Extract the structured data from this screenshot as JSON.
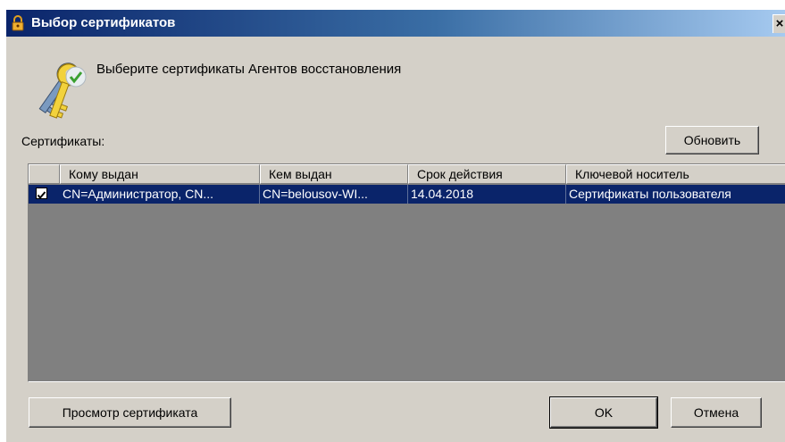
{
  "dialog": {
    "title": "Выбор сертификатов",
    "close_glyph": "×",
    "instruction": "Выберите сертификаты Агентов восстановления",
    "certificates_label": "Сертификаты:",
    "refresh_label": "Обновить",
    "view_label": "Просмотр сертификата",
    "ok_label": "OK",
    "cancel_label": "Отмена"
  },
  "table": {
    "columns": [
      "Кому выдан",
      "Кем выдан",
      "Срок действия",
      "Ключевой носитель"
    ],
    "rows": [
      {
        "checked": true,
        "cells": [
          "CN=Администратор, CN...",
          "CN=belousov-WI...",
          "14.04.2018",
          "Сертификаты пользователя"
        ]
      }
    ]
  },
  "icons": {
    "title": "lock-icon",
    "header": "keys-check-icon",
    "checkbox": "checkbox-checked"
  },
  "colors": {
    "title_gradient_start": "#0a246a",
    "title_gradient_end": "#a6caf0",
    "dialog_bg": "#d4d0c8",
    "list_bg": "#808080",
    "selection": "#0a246a"
  }
}
